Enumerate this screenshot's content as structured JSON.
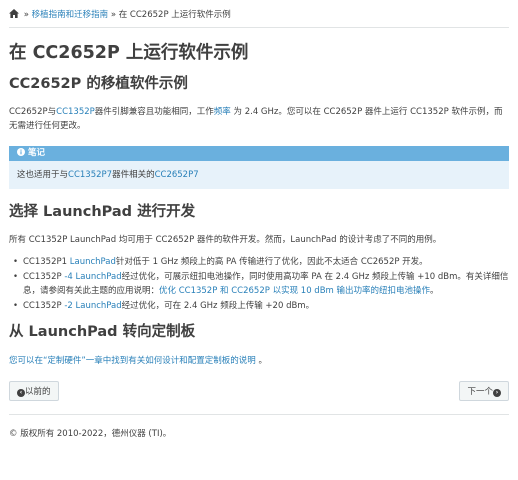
{
  "breadcrumb": {
    "home_icon": "home-icon",
    "sep1": " » ",
    "parent_link": "移植指南和迁移指南",
    "sep2": " » ",
    "current": "在 CC2652P 上运行软件示例"
  },
  "title": "在 CC2652P 上运行软件示例",
  "section1": {
    "heading": "CC2652P 的移植软件示例",
    "p_a": "CC2652P与",
    "p_link1": "CC1352P",
    "p_b": "器件引脚兼容且功能相同，工作",
    "p_link2": "频率",
    "p_c": " 为 2.4 GHz。您可以在 CC2652P 器件上运行 CC1352P 软件示例，而无需进行任何更改。"
  },
  "note": {
    "title_icon": "info-circle-icon",
    "title": "笔记",
    "body_a": "这也适用于与",
    "body_link1": "CC1352P7",
    "body_b": "器件相关的",
    "body_link2": "CC2652P7"
  },
  "section2": {
    "heading": "选择 LaunchPad 进行开发",
    "intro": "所有 CC1352P LaunchPad 均可用于 CC2652P 器件的软件开发。然而，LaunchPad 的设计考虑了不同的用例。",
    "items": [
      {
        "pre": "CC1352P1 ",
        "link": "LaunchPad",
        "post": "针对低于 1 GHz 频段上的高 PA 传输进行了优化，因此不太适合 CC2652P 开发。"
      },
      {
        "pre": "CC1352P ",
        "link": "-4 LaunchPad",
        "post": "经过优化，可展示纽扣电池操作，同时使用高功率 PA 在 2.4 GHz 频段上传输 +10 dBm。有关详细信息，请参阅有关此主题的应用说明：",
        "link2": "优化 CC1352P 和 CC2652P 以实现 10 dBm 输出功率的纽扣电池操作",
        "post2": "。"
      },
      {
        "pre": "CC1352P ",
        "link": "-2 LaunchPad",
        "post": "经过优化，可在 2.4 GHz 频段上传输 +20 dBm。"
      }
    ]
  },
  "section3": {
    "heading": "从 LaunchPad 转向定制板",
    "p_link": "您可以在“定制硬件”一章中找到有关如何设计和配置定制板的说明",
    "p_post": " 。"
  },
  "nav": {
    "prev_label": "以前的",
    "prev_icon": "arrow-circle-left-icon",
    "next_label": "下一个",
    "next_icon": "arrow-circle-right-icon"
  },
  "footer": "© 版权所有 2010-2022，德州仪器 (TI)。"
}
